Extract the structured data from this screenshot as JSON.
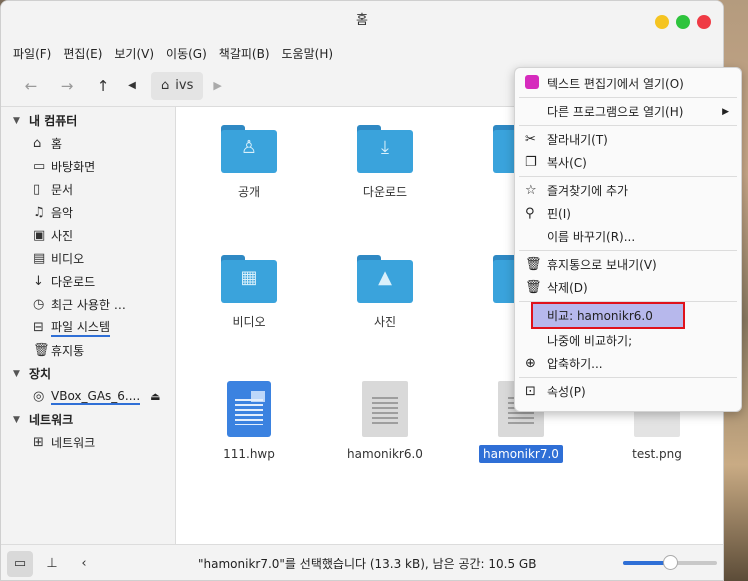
{
  "window": {
    "title": "홈"
  },
  "menubar": [
    "파일(F)",
    "편집(E)",
    "보기(V)",
    "이동(G)",
    "책갈피(B)",
    "도움말(H)"
  ],
  "toolbar": {
    "crumb": "ivs"
  },
  "sidebar": {
    "sections": [
      {
        "label": "내 컴퓨터",
        "items": [
          {
            "label": "홈",
            "icon": "home-icon"
          },
          {
            "label": "바탕화면",
            "icon": "desktop-icon"
          },
          {
            "label": "문서",
            "icon": "document-icon"
          },
          {
            "label": "음악",
            "icon": "music-icon"
          },
          {
            "label": "사진",
            "icon": "picture-icon"
          },
          {
            "label": "비디오",
            "icon": "video-icon"
          },
          {
            "label": "다운로드",
            "icon": "download-icon"
          },
          {
            "label": "최근 사용한 …",
            "icon": "recent-icon"
          },
          {
            "label": "파일 시스템",
            "icon": "drive-icon"
          },
          {
            "label": "휴지통",
            "icon": "trash-icon"
          }
        ]
      },
      {
        "label": "장치",
        "items": [
          {
            "label": "VBox_GAs_6....",
            "icon": "disc-icon"
          }
        ]
      },
      {
        "label": "네트워크",
        "items": [
          {
            "label": "네트워크",
            "icon": "network-icon"
          }
        ]
      }
    ]
  },
  "files": [
    {
      "label": "공개",
      "type": "folder",
      "glyph": "♙"
    },
    {
      "label": "다운로드",
      "type": "folder",
      "glyph": "⤓"
    },
    {
      "label": "문",
      "type": "folder",
      "glyph": ""
    },
    {
      "label": "비디오",
      "type": "folder",
      "glyph": "▦"
    },
    {
      "label": "사진",
      "type": "folder",
      "glyph": "▲"
    },
    {
      "label": "음",
      "type": "folder",
      "glyph": ""
    },
    {
      "label": "111.hwp",
      "type": "hwp"
    },
    {
      "label": "hamonikr6.0",
      "type": "doc"
    },
    {
      "label": "hamonikr7.0",
      "type": "doc",
      "selected": true
    },
    {
      "label": "test.png",
      "type": "image"
    }
  ],
  "context_menu": [
    {
      "label": "텍스트 편집기에서 열기(O)",
      "icon": "text-editor-icon"
    },
    {
      "sep": true
    },
    {
      "label": "다른 프로그램으로 열기(H)",
      "icon": "",
      "submenu": true
    },
    {
      "sep": true
    },
    {
      "label": "잘라내기(T)",
      "icon": "scissors-icon"
    },
    {
      "label": "복사(C)",
      "icon": "copy-icon"
    },
    {
      "sep": true
    },
    {
      "label": "즐겨찾기에 추가",
      "icon": "star-add-icon"
    },
    {
      "label": "핀(I)",
      "icon": "pin-icon"
    },
    {
      "label": "이름 바꾸기(R)...",
      "icon": ""
    },
    {
      "sep": true
    },
    {
      "label": "휴지통으로 보내기(V)",
      "icon": "trash-icon"
    },
    {
      "label": "삭제(D)",
      "icon": "delete-icon"
    },
    {
      "sep": true
    },
    {
      "label": "비교: hamonikr6.0",
      "icon": "",
      "highlight": true
    },
    {
      "label": "나중에 비교하기;",
      "icon": ""
    },
    {
      "label": "압축하기...",
      "icon": "archive-icon"
    },
    {
      "sep": true
    },
    {
      "label": "속성(P)",
      "icon": "properties-icon"
    }
  ],
  "statusbar": {
    "text": "\"hamonikr7.0\"를 선택했습니다 (13.3 kB), 남은 공간: 10.5 GB",
    "zoom": 0.5
  }
}
